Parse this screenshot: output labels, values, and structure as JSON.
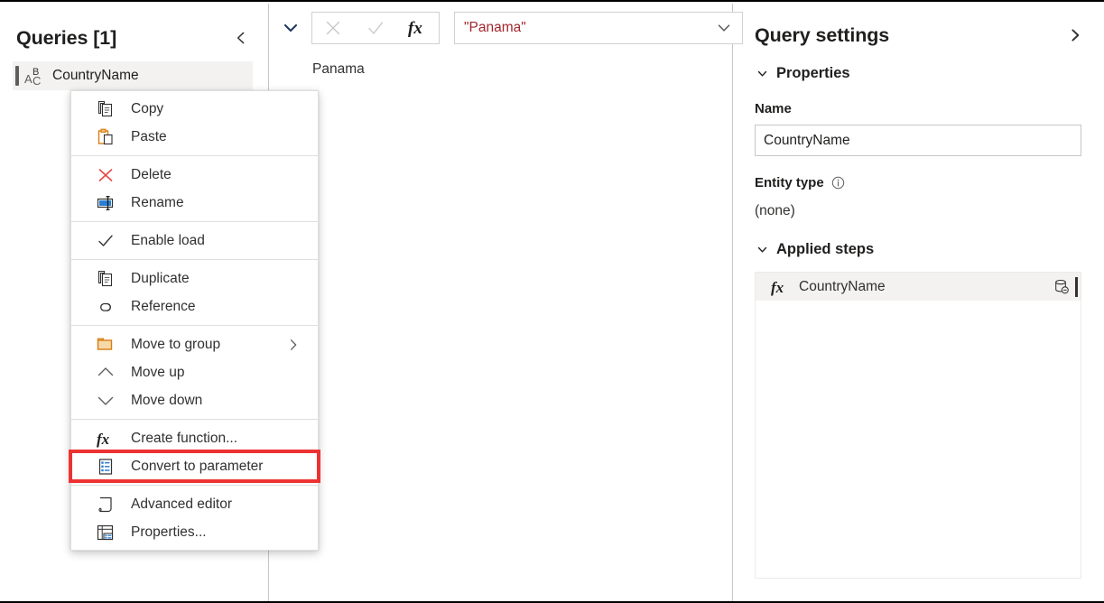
{
  "queries_pane": {
    "title": "Queries [1]",
    "collapse_icon": "chevron-left-icon",
    "items": [
      {
        "label": "CountryName",
        "icon": "abc-text-type-icon",
        "selected": true
      }
    ]
  },
  "context_menu": {
    "groups": [
      {
        "items": [
          {
            "label": "Copy",
            "icon": "copy-icon"
          },
          {
            "label": "Paste",
            "icon": "paste-icon"
          }
        ]
      },
      {
        "items": [
          {
            "label": "Delete",
            "icon": "delete-x-icon"
          },
          {
            "label": "Rename",
            "icon": "rename-icon"
          }
        ]
      },
      {
        "items": [
          {
            "label": "Enable load",
            "icon": "checkmark-icon",
            "checked": true
          }
        ]
      },
      {
        "items": [
          {
            "label": "Duplicate",
            "icon": "duplicate-icon"
          },
          {
            "label": "Reference",
            "icon": "reference-link-icon"
          }
        ]
      },
      {
        "items": [
          {
            "label": "Move to group",
            "icon": "folder-icon",
            "submenu": true,
            "submenu_icon": "chevron-right-icon"
          },
          {
            "label": "Move up",
            "icon": "chevron-up-icon"
          },
          {
            "label": "Move down",
            "icon": "chevron-down-icon"
          }
        ]
      },
      {
        "items": [
          {
            "label": "Create function...",
            "icon": "fx-icon"
          },
          {
            "label": "Convert to parameter",
            "icon": "parameter-list-icon",
            "highlighted": true
          }
        ]
      },
      {
        "items": [
          {
            "label": "Advanced editor",
            "icon": "advanced-editor-scroll-icon"
          },
          {
            "label": "Properties...",
            "icon": "properties-table-icon"
          }
        ]
      }
    ],
    "highlight_color": "#ed3232"
  },
  "formula_bar": {
    "expand_icon": "chevron-down-icon",
    "cancel_icon": "close-x-icon",
    "confirm_icon": "checkmark-icon",
    "fx_icon": "fx-icon",
    "value": "\"Panama\"",
    "value_color": "#a4262c",
    "dropdown_icon": "chevron-down-icon"
  },
  "preview": {
    "value": "Panama"
  },
  "query_settings": {
    "title": "Query settings",
    "collapse_icon": "chevron-right-icon",
    "properties": {
      "section_label": "Properties",
      "section_chevron": "chevron-down-icon",
      "name_label": "Name",
      "name_value": "CountryName",
      "entity_type_label": "Entity type",
      "entity_type_info_icon": "info-circle-icon",
      "entity_type_value": "(none)"
    },
    "applied_steps": {
      "section_label": "Applied steps",
      "section_chevron": "chevron-down-icon",
      "steps": [
        {
          "label": "CountryName",
          "icon": "fx-icon",
          "action_icon": "database-minus-icon",
          "selected": true
        }
      ]
    }
  }
}
